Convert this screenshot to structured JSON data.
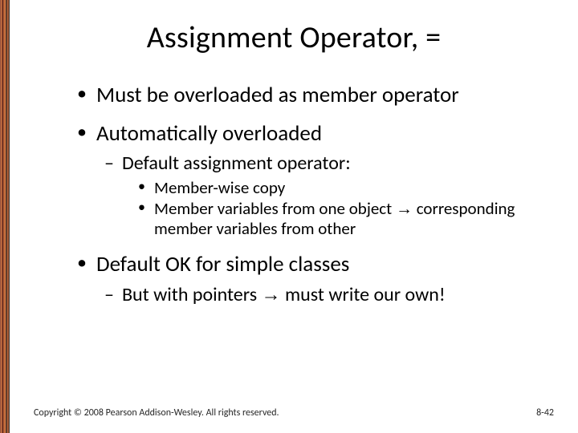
{
  "title": "Assignment Operator, =",
  "bullets": {
    "b1": "Must be overloaded as member operator",
    "b2": "Automatically overloaded",
    "b2_1": "Default assignment operator:",
    "b2_1_1": "Member-wise copy",
    "b2_1_2_a": "Member variables from one object ",
    "b2_1_2_arrow": "→",
    "b2_1_2_b": " corresponding member variables from other",
    "b3": "Default OK for simple classes",
    "b3_1_a": "But with pointers ",
    "b3_1_arrow": "→",
    "b3_1_b": " must write our own!"
  },
  "footer": {
    "copyright": "Copyright © 2008 Pearson Addison-Wesley. All rights reserved.",
    "pagenum": "8-42"
  }
}
